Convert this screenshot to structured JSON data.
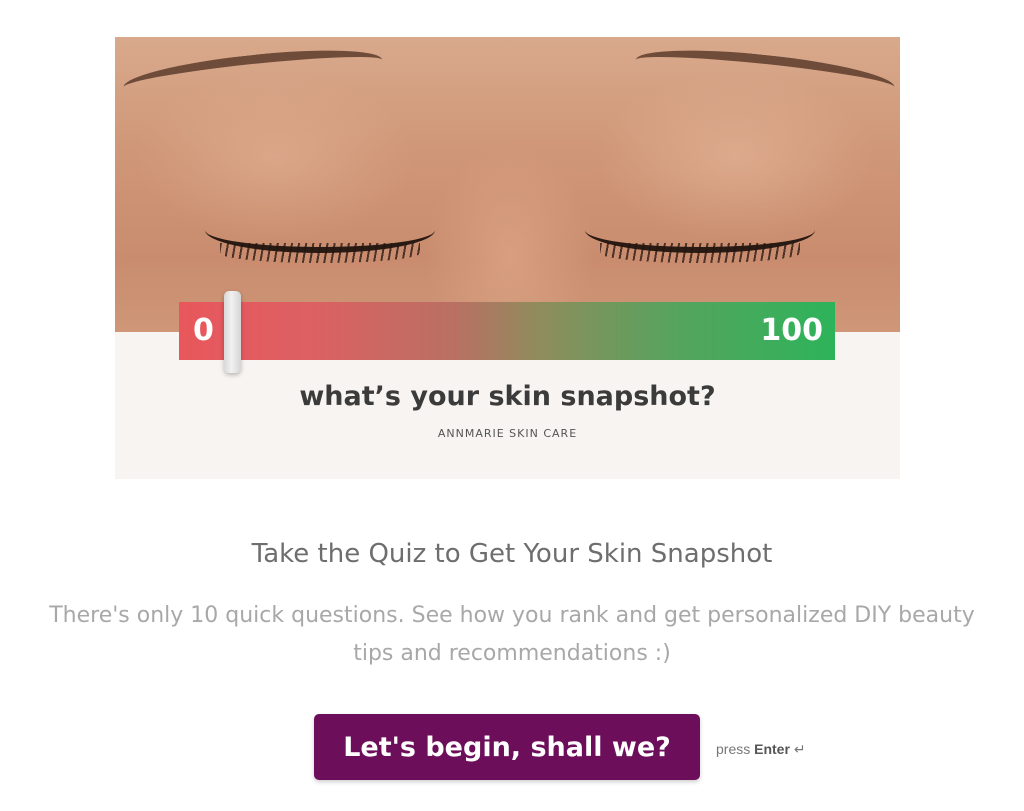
{
  "hero": {
    "meter": {
      "min_label": "0",
      "max_label": "100",
      "value": 0
    },
    "title": "what’s your skin snapshot?",
    "brand": "ANNMARIE SKIN CARE"
  },
  "content": {
    "heading": "Take the Quiz to Get Your Skin Snapshot",
    "subtext": "There's only 10 quick questions. See how you rank and get personalized DIY beauty tips and recommendations :)"
  },
  "cta": {
    "label": "Let's begin, shall we?",
    "hint_prefix": "press",
    "hint_key": "Enter",
    "hint_icon": "↵"
  },
  "colors": {
    "cta_background": "#6d0e5a",
    "meter_low": "#e8575c",
    "meter_high": "#2db35a"
  }
}
